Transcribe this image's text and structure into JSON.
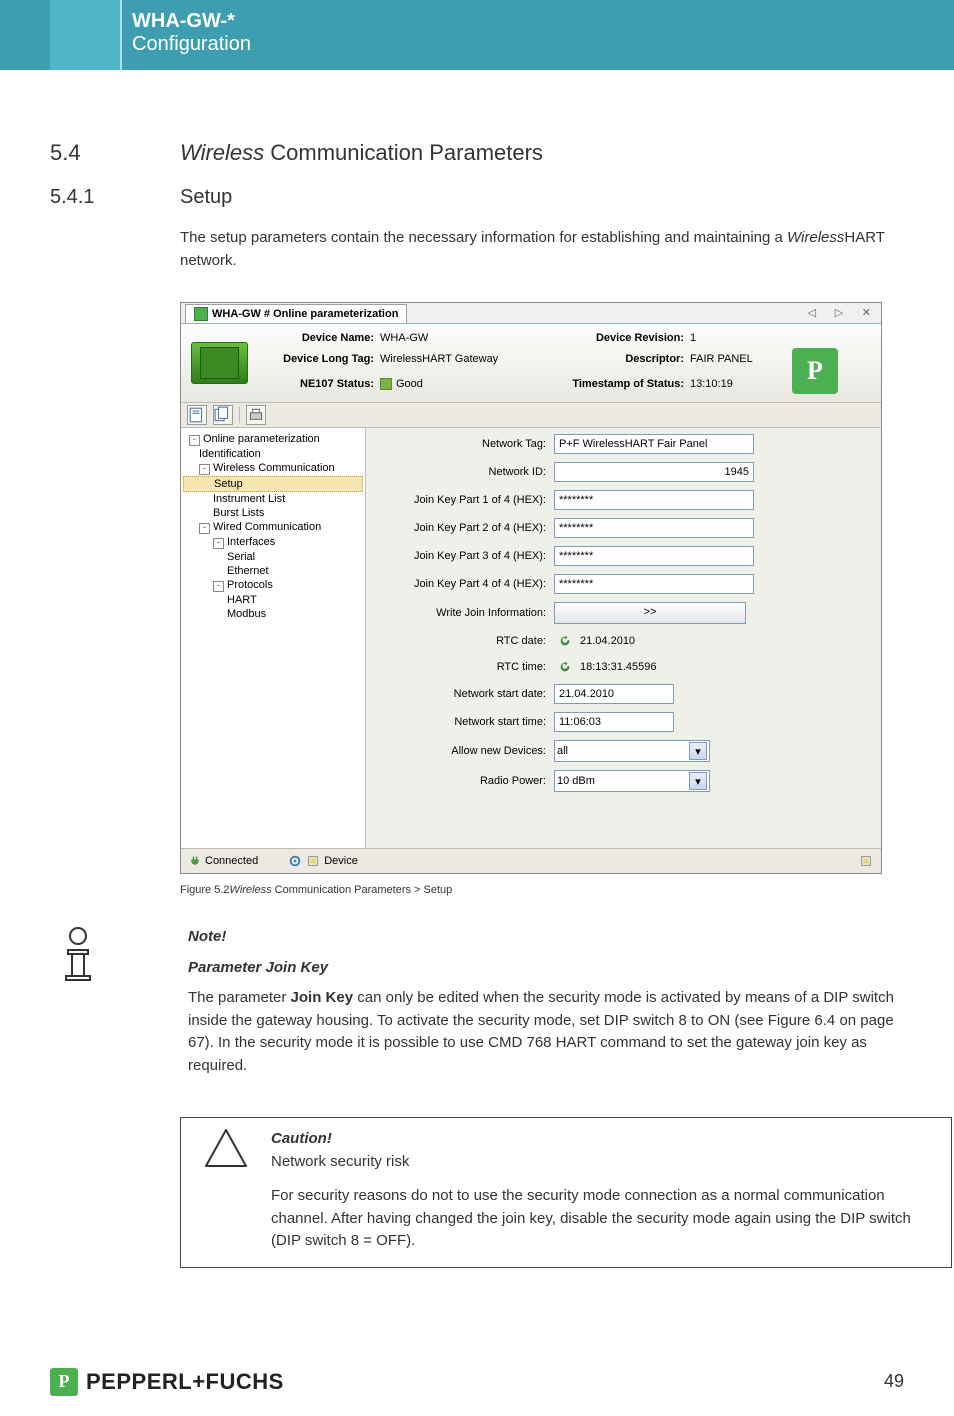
{
  "header": {
    "line1": "WHA-GW-*",
    "line2": "Configuration"
  },
  "section": {
    "num": "5.4",
    "title_prefix_italic": "Wireless",
    "title_rest": " Communication Parameters"
  },
  "subsection": {
    "num": "5.4.1",
    "title": "Setup"
  },
  "intro_p1_a": "The setup parameters contain the necessary information for establishing and maintaining a ",
  "intro_p1_b_italic": "Wireless",
  "intro_p1_c": "HART network.",
  "shot": {
    "tab_title": "WHA-GW # Online parameterization",
    "tab_controls": "◁ ▷ ✕",
    "hdr": {
      "device_name_l": "Device Name:",
      "device_name_v": "WHA-GW",
      "device_long_tag_l": "Device Long Tag:",
      "device_long_tag_v": "WirelessHART Gateway",
      "ne107_l": "NE107 Status:",
      "ne107_v": "Good",
      "device_rev_l": "Device Revision:",
      "device_rev_v": "1",
      "descriptor_l": "Descriptor:",
      "descriptor_v": "FAIR PANEL",
      "ts_l": "Timestamp of Status:",
      "ts_v": "13:10:19"
    },
    "tree": {
      "root": "Online parameterization",
      "ident": "Identification",
      "wc": "Wireless Communication",
      "setup": "Setup",
      "instr": "Instrument List",
      "burst": "Burst Lists",
      "wired": "Wired Communication",
      "ifaces": "Interfaces",
      "serial": "Serial",
      "eth": "Ethernet",
      "protos": "Protocols",
      "hart": "HART",
      "modbus": "Modbus"
    },
    "form": {
      "network_tag_l": "Network Tag:",
      "network_tag_v": "P+F WirelessHART Fair Panel",
      "network_id_l": "Network ID:",
      "network_id_v": "1945",
      "jk1_l": "Join Key Part 1 of 4 (HEX):",
      "jk1_v": "********",
      "jk2_l": "Join Key Part 2 of 4 (HEX):",
      "jk2_v": "********",
      "jk3_l": "Join Key Part 3 of 4 (HEX):",
      "jk3_v": "********",
      "jk4_l": "Join Key Part 4 of 4 (HEX):",
      "jk4_v": "********",
      "write_join_l": "Write Join Information:",
      "write_join_btn": ">>",
      "rtc_date_l": "RTC date:",
      "rtc_date_v": "21.04.2010",
      "rtc_time_l": "RTC time:",
      "rtc_time_v": "18:13:31.45596",
      "net_start_date_l": "Network start date:",
      "net_start_date_v": "21.04.2010",
      "net_start_time_l": "Network start time:",
      "net_start_time_v": "11:06:03",
      "allow_new_l": "Allow new Devices:",
      "allow_new_v": "all",
      "radio_power_l": "Radio Power:",
      "radio_power_v": "10 dBm"
    },
    "status": {
      "connected": "Connected",
      "device": "Device"
    }
  },
  "figcap": {
    "prefix": "Figure 5.2",
    "italic": "Wireless",
    "rest": " Communication Parameters > Setup"
  },
  "note": {
    "heading": "Note!",
    "subheading": "Parameter Join Key",
    "body_a": "The parameter ",
    "body_bold": "Join Key",
    "body_b": " can only be edited when the security mode is activated by means of a DIP switch inside the gateway housing. To activate the security mode, set DIP switch 8 to ON (see Figure 6.4 on page 67). In the security mode it is possible to use CMD 768 HART command to set the gateway join key as required."
  },
  "caution": {
    "heading": "Caution!",
    "sub": "Network security risk",
    "body": "For security reasons do not to use the security mode connection as a normal communication channel. After having changed the join key, disable the security mode again using the DIP switch (DIP switch 8 = OFF)."
  },
  "footer": {
    "brand": "PEPPERL+FUCHS",
    "page": "49"
  }
}
